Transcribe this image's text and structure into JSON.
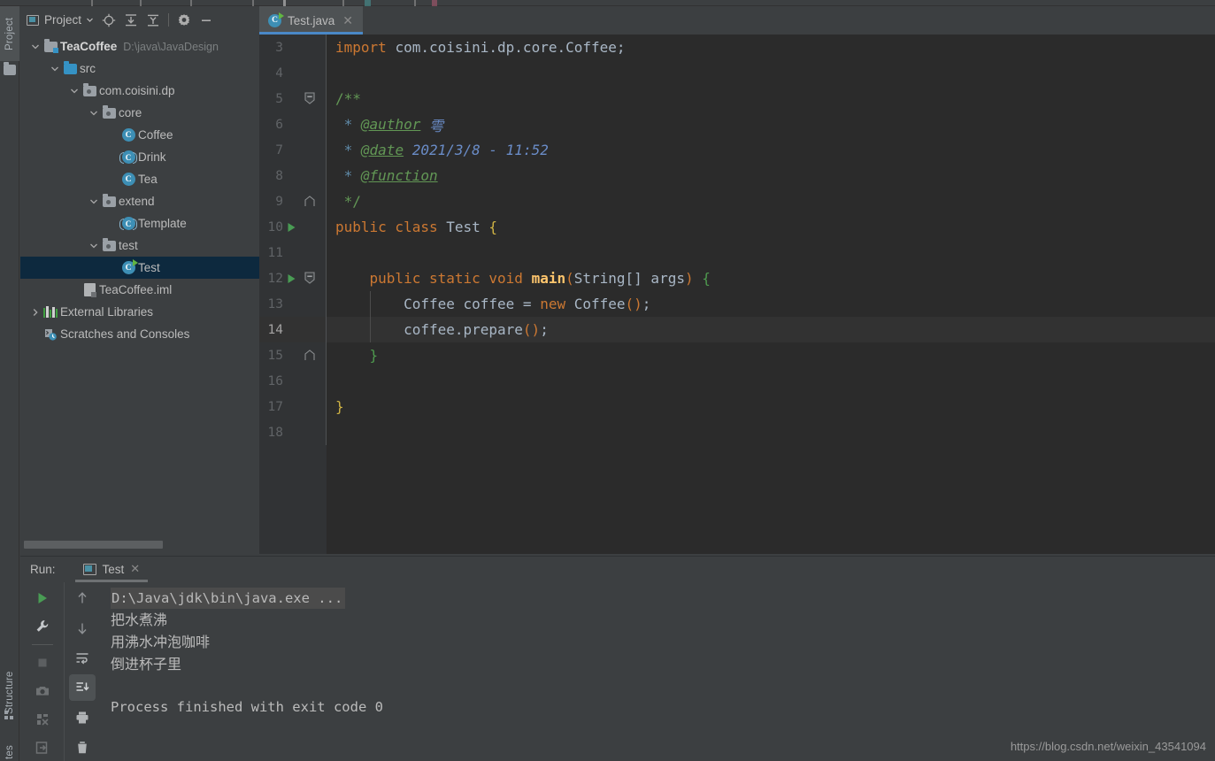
{
  "window": {
    "theme": "darcula",
    "accent_color": "#4a88c7",
    "editor_bg": "#2b2b2b",
    "panel_bg": "#3c3f41",
    "selection_bg": "#0d293e"
  },
  "left_strip": {
    "top_label": "Project",
    "structure_label": "Structure",
    "bottom_label": "tes",
    "folder_icon": "folder-icon",
    "structure_icon": "structure-icon"
  },
  "project_panel": {
    "title": "Project",
    "title_icon": "project-window-icon",
    "toolbar": [
      {
        "name": "locate-target-icon",
        "label": "Select Opened File"
      },
      {
        "name": "expand-all-icon",
        "label": "Expand All"
      },
      {
        "name": "collapse-all-icon",
        "label": "Collapse All"
      },
      {
        "name": "gear-icon",
        "label": "Settings"
      },
      {
        "name": "minimize-icon",
        "label": "Hide"
      }
    ],
    "tree": [
      {
        "label": "TeaCoffee",
        "path": "D:\\java\\JavaDesign",
        "icon": "module-folder-icon",
        "depth": 0,
        "arrow": "down",
        "bold": true,
        "selected": false
      },
      {
        "label": "src",
        "path": "",
        "icon": "source-folder-icon",
        "depth": 1,
        "arrow": "down",
        "bold": false,
        "selected": false
      },
      {
        "label": "com.coisini.dp",
        "path": "",
        "icon": "package-icon",
        "depth": 2,
        "arrow": "down",
        "bold": false,
        "selected": false
      },
      {
        "label": "core",
        "path": "",
        "icon": "package-icon",
        "depth": 3,
        "arrow": "down",
        "bold": false,
        "selected": false
      },
      {
        "label": "Coffee",
        "path": "",
        "icon": "java-class-icon",
        "depth": 4,
        "arrow": "none",
        "bold": false,
        "selected": false
      },
      {
        "label": "Drink",
        "path": "",
        "icon": "java-interface-icon",
        "depth": 4,
        "arrow": "none",
        "bold": false,
        "selected": false
      },
      {
        "label": "Tea",
        "path": "",
        "icon": "java-class-icon",
        "depth": 4,
        "arrow": "none",
        "bold": false,
        "selected": false
      },
      {
        "label": "extend",
        "path": "",
        "icon": "package-icon",
        "depth": 3,
        "arrow": "down",
        "bold": false,
        "selected": false
      },
      {
        "label": "Template",
        "path": "",
        "icon": "java-interface-icon",
        "depth": 4,
        "arrow": "none",
        "bold": false,
        "selected": false
      },
      {
        "label": "test",
        "path": "",
        "icon": "package-icon",
        "depth": 3,
        "arrow": "down",
        "bold": false,
        "selected": false
      },
      {
        "label": "Test",
        "path": "",
        "icon": "java-runnable-class-icon",
        "depth": 4,
        "arrow": "none",
        "bold": false,
        "selected": true
      },
      {
        "label": "TeaCoffee.iml",
        "path": "",
        "icon": "iml-file-icon",
        "depth": 2,
        "arrow": "none",
        "bold": false,
        "selected": false
      },
      {
        "label": "External Libraries",
        "path": "",
        "icon": "libraries-icon",
        "depth": 0,
        "arrow": "right",
        "bold": false,
        "selected": false
      },
      {
        "label": "Scratches and Consoles",
        "path": "",
        "icon": "scratches-icon",
        "depth": 0,
        "arrow": "none",
        "bold": false,
        "selected": false
      }
    ]
  },
  "editor": {
    "tab": {
      "label": "Test.java",
      "icon": "java-runnable-class-icon",
      "close_icon": "close-icon",
      "active": true
    },
    "first_line_number": 3,
    "current_line": 14,
    "gutter": {
      "run_arrow_lines": [
        10,
        12
      ],
      "fold_open_lines": [
        5,
        12
      ],
      "fold_close_lines": [
        9,
        15
      ]
    },
    "lines": [
      {
        "n": 3,
        "tokens": [
          {
            "t": "import ",
            "c": "kw"
          },
          {
            "t": "com.coisini.dp.core.Coffee;",
            "c": "txt"
          }
        ]
      },
      {
        "n": 4,
        "tokens": []
      },
      {
        "n": 5,
        "tokens": [
          {
            "t": "/**",
            "c": "cmt-blue"
          }
        ]
      },
      {
        "n": 6,
        "tokens": [
          {
            "t": " * ",
            "c": "doc-star"
          },
          {
            "t": "@author",
            "c": "doc-tag"
          },
          {
            "t": " 雩",
            "c": "doc-val"
          }
        ]
      },
      {
        "n": 7,
        "tokens": [
          {
            "t": " * ",
            "c": "doc-star"
          },
          {
            "t": "@date",
            "c": "doc-tag"
          },
          {
            "t": " 2021/3/8 - 11:52",
            "c": "doc-val"
          }
        ]
      },
      {
        "n": 8,
        "tokens": [
          {
            "t": " * ",
            "c": "doc-star"
          },
          {
            "t": "@function",
            "c": "doc-tag"
          }
        ]
      },
      {
        "n": 9,
        "tokens": [
          {
            "t": " */",
            "c": "cmt-blue"
          }
        ]
      },
      {
        "n": 10,
        "tokens": [
          {
            "t": "public class ",
            "c": "kw"
          },
          {
            "t": "Test ",
            "c": "txt"
          },
          {
            "t": "{",
            "c": "brace-y"
          }
        ]
      },
      {
        "n": 11,
        "tokens": []
      },
      {
        "n": 12,
        "tokens": [
          {
            "t": "    ",
            "c": "txt"
          },
          {
            "t": "public static void ",
            "c": "kw"
          },
          {
            "t": "main",
            "c": "mth"
          },
          {
            "t": "(",
            "c": "paren-o"
          },
          {
            "t": "String[] args",
            "c": "txt"
          },
          {
            "t": ")",
            "c": "paren-o"
          },
          {
            "t": " ",
            "c": "txt"
          },
          {
            "t": "{",
            "c": "brace-g"
          }
        ]
      },
      {
        "n": 13,
        "tokens": [
          {
            "t": "        Coffee coffee = ",
            "c": "txt"
          },
          {
            "t": "new ",
            "c": "kw"
          },
          {
            "t": "Coffee",
            "c": "txt"
          },
          {
            "t": "()",
            "c": "paren-o"
          },
          {
            "t": ";",
            "c": "txt"
          }
        ]
      },
      {
        "n": 14,
        "tokens": [
          {
            "t": "        coffee.prepare",
            "c": "txt"
          },
          {
            "t": "()",
            "c": "paren-o"
          },
          {
            "t": ";",
            "c": "txt"
          }
        ]
      },
      {
        "n": 15,
        "tokens": [
          {
            "t": "    ",
            "c": "txt"
          },
          {
            "t": "}",
            "c": "brace-g"
          }
        ]
      },
      {
        "n": 16,
        "tokens": []
      },
      {
        "n": 17,
        "tokens": [
          {
            "t": "}",
            "c": "brace-y"
          }
        ]
      },
      {
        "n": 18,
        "tokens": []
      }
    ]
  },
  "run_panel": {
    "label": "Run:",
    "tab": {
      "label": "Test",
      "icon": "run-configuration-icon",
      "close_icon": "close-icon"
    },
    "left_toolbar": [
      {
        "name": "rerun-icon",
        "label": "Rerun",
        "active": false
      },
      {
        "name": "edit-configurations-icon",
        "label": "Edit Configurations",
        "active": false
      },
      {
        "name": "stop-icon",
        "label": "Stop",
        "active": false
      },
      {
        "name": "camera-icon",
        "label": "Dump Threads",
        "active": false
      },
      {
        "name": "restore-layout-icon",
        "label": "Restore Layout",
        "active": false
      },
      {
        "name": "pin-tab-icon",
        "label": "Pin Tab",
        "active": false
      }
    ],
    "right_toolbar": [
      {
        "name": "arrow-up-icon",
        "label": "Up",
        "active": false
      },
      {
        "name": "arrow-down-icon",
        "label": "Down",
        "active": false
      },
      {
        "name": "soft-wrap-icon",
        "label": "Use Soft Wraps",
        "active": false
      },
      {
        "name": "scroll-to-end-icon",
        "label": "Scroll to End",
        "active": true
      },
      {
        "name": "print-icon",
        "label": "Print",
        "active": false
      },
      {
        "name": "trash-icon",
        "label": "Clear All",
        "active": false
      }
    ],
    "console": [
      {
        "text": "D:\\Java\\jdk\\bin\\java.exe ...",
        "style": "cmdline"
      },
      {
        "text": "把水煮沸",
        "style": "cjk"
      },
      {
        "text": "用沸水冲泡咖啡",
        "style": "cjk"
      },
      {
        "text": "倒进杯子里",
        "style": "cjk"
      },
      {
        "text": "",
        "style": "plain"
      },
      {
        "text": "Process finished with exit code 0",
        "style": "plain"
      }
    ]
  },
  "watermark": {
    "text": "https://blog.csdn.net/weixin_43541094"
  }
}
